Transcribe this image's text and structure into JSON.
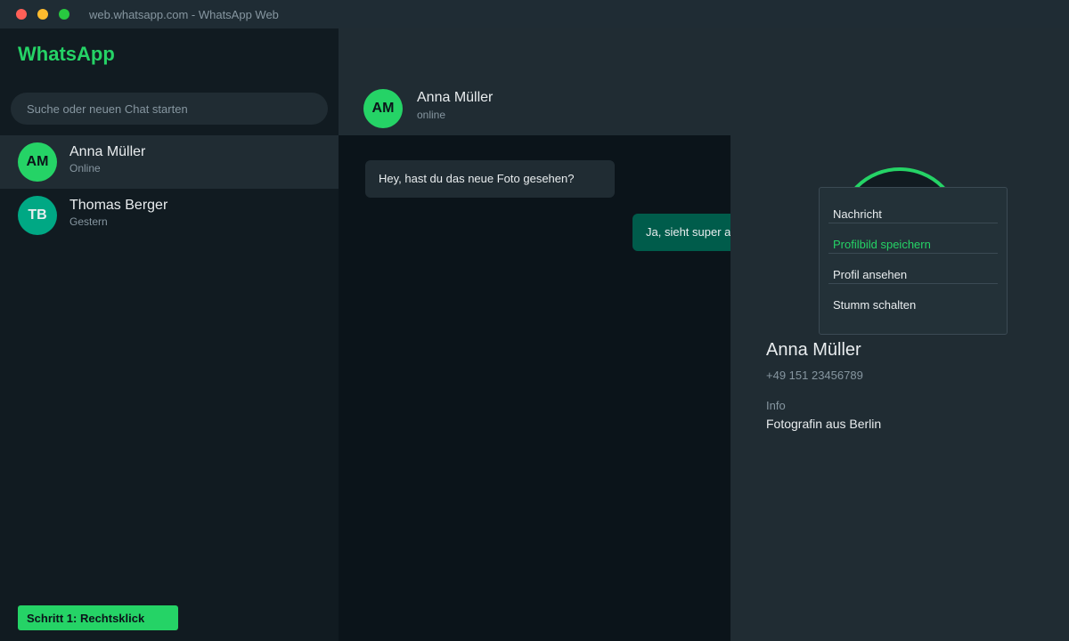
{
  "window": {
    "title": "web.whatsapp.com - WhatsApp Web"
  },
  "sidebar": {
    "brand": "WhatsApp",
    "search_placeholder": "Suche oder neuen Chat starten",
    "chats": [
      {
        "initials": "AM",
        "name": "Anna Müller",
        "subtitle": "Online",
        "avatar_color": "#25d366",
        "active": true
      },
      {
        "initials": "TB",
        "name": "Thomas Berger",
        "subtitle": "Gestern",
        "avatar_color": "#00a884",
        "active": false
      }
    ],
    "step_badge": "Schritt 1: Rechtsklick"
  },
  "chat_header": {
    "initials": "AM",
    "name": "Anna Müller",
    "status": "online"
  },
  "messages": [
    {
      "direction": "incoming",
      "text": "Hey, hast du das neue Foto gesehen?"
    },
    {
      "direction": "outgoing",
      "text": "Ja, sieht super aus!"
    }
  ],
  "contact_info": {
    "name": "Anna Müller",
    "phone": "+49 151 23456789",
    "about_label": "Info",
    "about_text": "Fotografin aus Berlin"
  },
  "context_menu": {
    "items": [
      {
        "label": "Nachricht"
      },
      {
        "label": "Profilbild speichern",
        "highlighted": true
      },
      {
        "label": "Profil ansehen"
      },
      {
        "label": "Stumm schalten"
      }
    ]
  },
  "colors": {
    "accent": "#25d366",
    "outgoing_bubble": "#005c4b",
    "panel": "#202c33",
    "background": "#0b141a"
  }
}
